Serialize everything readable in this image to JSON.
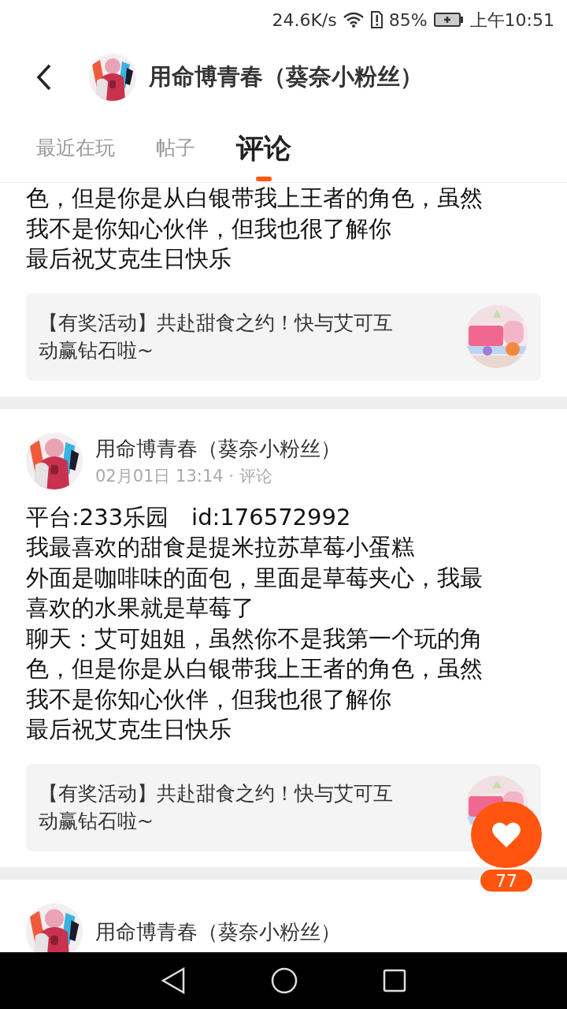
{
  "status_bar": {
    "net_speed": "24.6K/s",
    "battery_percent": "85%",
    "time": "上午10:51"
  },
  "header": {
    "title": "用命博青春（葵奈小粉丝）"
  },
  "tabs": [
    {
      "label": "最近在玩",
      "selected": false
    },
    {
      "label": "帖子",
      "selected": false
    },
    {
      "label": "评论",
      "selected": true
    }
  ],
  "posts": [
    {
      "lines": [
        "色，但是你是从白银带我上王者的角色，虽然",
        "我不是你知心伙伴，但我也很了解你",
        "最后祝艾克生日快乐"
      ],
      "activity": {
        "text": "【有奖活动】共赴甜食之约！快与艾可互动赢钻石啦~"
      }
    },
    {
      "author": "用命博青春（葵奈小粉丝）",
      "meta": "02月01日 13:14 · 评论",
      "lines": [
        "平台:233乐园　id:176572992",
        "我最喜欢的甜食是提米拉苏草莓小蛋糕",
        "外面是咖啡味的面包，里面是草莓夹心，我最",
        "喜欢的水果就是草莓了",
        "聊天：艾可姐姐，虽然你不是我第一个玩的角",
        "色，但是你是从白银带我上王者的角色，虽然",
        "我不是你知心伙伴，但我也很了解你",
        "最后祝艾克生日快乐"
      ],
      "activity": {
        "text": "【有奖活动】共赴甜食之约！快与艾可互动赢钻石啦~"
      }
    },
    {
      "author": "用命博青春（葵奈小粉丝）"
    }
  ],
  "like_button": {
    "count": "77"
  }
}
